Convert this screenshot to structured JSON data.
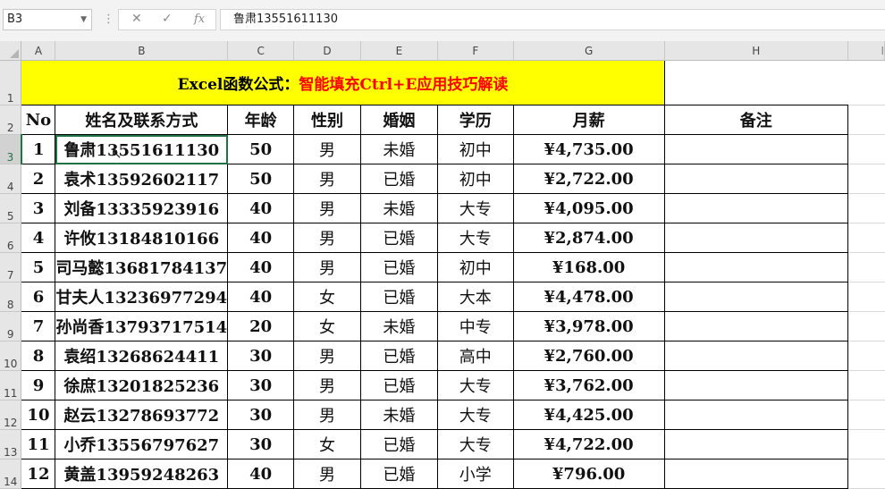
{
  "formula_bar": {
    "name_box": "B3",
    "fx_label": "fx",
    "cancel_icon": "close-icon",
    "enter_icon": "check-icon",
    "formula_value": "鲁肃13551611130"
  },
  "columns": [
    "A",
    "B",
    "C",
    "D",
    "E",
    "F",
    "G",
    "H"
  ],
  "title": {
    "part1": "Excel函数公式：",
    "part2": "智能填充Ctrl+E应用技巧解读"
  },
  "headers": {
    "no": "No",
    "name": "姓名及联系方式",
    "age": "年龄",
    "gender": "性别",
    "marriage": "婚姻",
    "education": "学历",
    "salary": "月薪",
    "remark": "备注"
  },
  "rows": [
    {
      "row": "3",
      "no": "1",
      "name": "鲁肃13551611130",
      "age": "50",
      "gender": "男",
      "marriage": "未婚",
      "education": "初中",
      "salary": "¥4,735.00"
    },
    {
      "row": "4",
      "no": "2",
      "name": "袁术13592602117",
      "age": "50",
      "gender": "男",
      "marriage": "已婚",
      "education": "初中",
      "salary": "¥2,722.00"
    },
    {
      "row": "5",
      "no": "3",
      "name": "刘备13335923916",
      "age": "40",
      "gender": "男",
      "marriage": "未婚",
      "education": "大专",
      "salary": "¥4,095.00"
    },
    {
      "row": "6",
      "no": "4",
      "name": "许攸13184810166",
      "age": "40",
      "gender": "男",
      "marriage": "已婚",
      "education": "大专",
      "salary": "¥2,874.00"
    },
    {
      "row": "7",
      "no": "5",
      "name": "司马懿13681784137",
      "age": "40",
      "gender": "男",
      "marriage": "已婚",
      "education": "初中",
      "salary": "¥168.00"
    },
    {
      "row": "8",
      "no": "6",
      "name": "甘夫人13236977294",
      "age": "40",
      "gender": "女",
      "marriage": "已婚",
      "education": "大本",
      "salary": "¥4,478.00"
    },
    {
      "row": "9",
      "no": "7",
      "name": "孙尚香13793717514",
      "age": "20",
      "gender": "女",
      "marriage": "未婚",
      "education": "中专",
      "salary": "¥3,978.00"
    },
    {
      "row": "10",
      "no": "8",
      "name": "袁绍13268624411",
      "age": "30",
      "gender": "男",
      "marriage": "已婚",
      "education": "高中",
      "salary": "¥2,760.00"
    },
    {
      "row": "11",
      "no": "9",
      "name": "徐庶13201825236",
      "age": "30",
      "gender": "男",
      "marriage": "已婚",
      "education": "大专",
      "salary": "¥3,762.00"
    },
    {
      "row": "12",
      "no": "10",
      "name": "赵云13278693772",
      "age": "30",
      "gender": "男",
      "marriage": "未婚",
      "education": "大专",
      "salary": "¥4,425.00"
    },
    {
      "row": "13",
      "no": "11",
      "name": "小乔13556797627",
      "age": "30",
      "gender": "女",
      "marriage": "已婚",
      "education": "大专",
      "salary": "¥4,722.00"
    },
    {
      "row": "14",
      "no": "12",
      "name": "黄盖13959248263",
      "age": "40",
      "gender": "男",
      "marriage": "已婚",
      "education": "小学",
      "salary": "¥796.00"
    }
  ],
  "colors": {
    "title_bg": "#ffff00",
    "title_accent": "#ff0000",
    "selection": "#217346"
  }
}
